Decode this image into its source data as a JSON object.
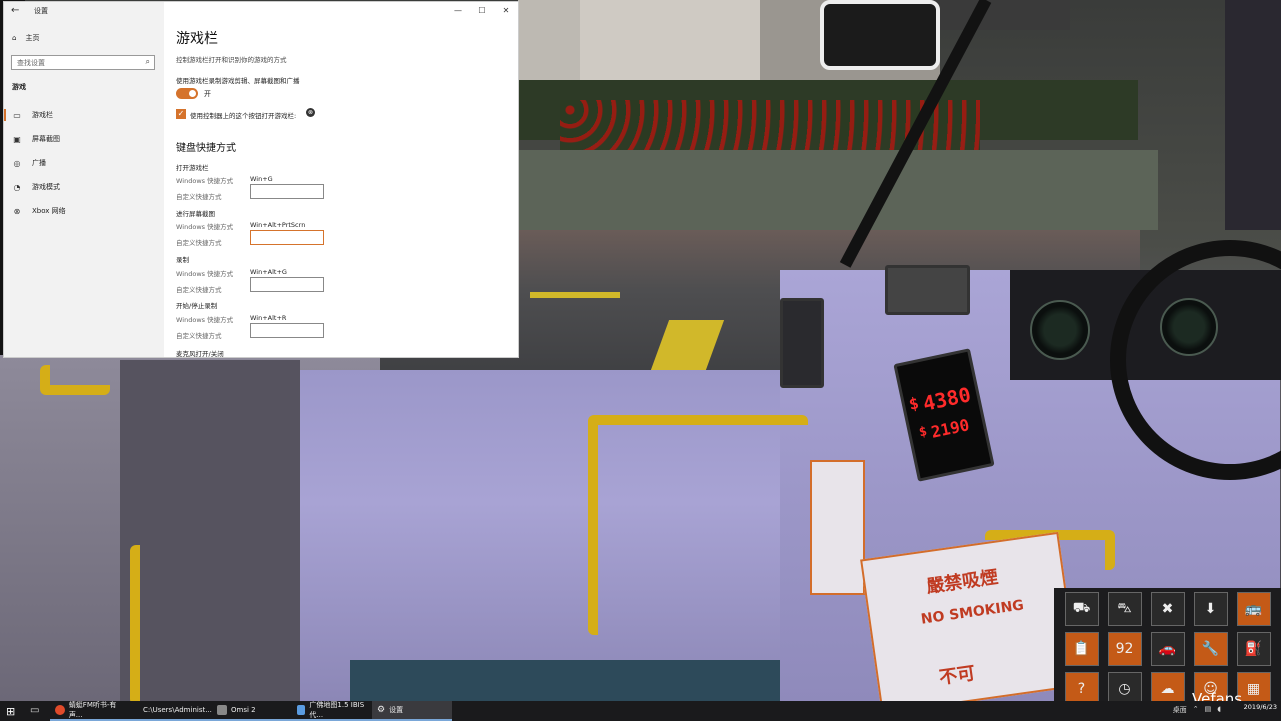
{
  "window": {
    "title": "设置",
    "controls": {
      "minimize": "—",
      "maximize": "☐",
      "close": "✕"
    }
  },
  "sidebar": {
    "home_label": "主页",
    "search_placeholder": "查找设置",
    "section_label": "游戏",
    "items": [
      {
        "label": "游戏栏",
        "icon": "game-bar-icon",
        "active": true
      },
      {
        "label": "屏幕截图",
        "icon": "screenshot-icon",
        "active": false
      },
      {
        "label": "广播",
        "icon": "broadcast-icon",
        "active": false
      },
      {
        "label": "游戏模式",
        "icon": "game-mode-icon",
        "active": false
      },
      {
        "label": "Xbox 网络",
        "icon": "xbox-icon",
        "active": false
      }
    ]
  },
  "content": {
    "title": "游戏栏",
    "description": "控制游戏栏打开和识别你的游戏的方式",
    "record_option_label": "使用游戏栏录制游戏剪辑、屏幕截图和广播",
    "toggle_state": "开",
    "checkbox_label": "使用控制器上的这个按钮打开游戏栏:",
    "shortcuts_heading": "键盘快捷方式",
    "windows_shortcut_label": "Windows 快捷方式",
    "custom_shortcut_label": "自定义快捷方式",
    "shortcuts": [
      {
        "title": "打开游戏栏",
        "windows": "Win+G"
      },
      {
        "title": "进行屏幕截图",
        "windows": "Win+Alt+PrtScrn"
      },
      {
        "title": "录制",
        "windows": "Win+Alt+G"
      },
      {
        "title": "开始/停止录制",
        "windows": "Win+Alt+R"
      }
    ],
    "next_title": "麦克风打开/关闭"
  },
  "game": {
    "fare_top": "4380",
    "fare_bottom": "2190",
    "fare_symbol": "$",
    "sign_text_1": "嚴禁吸煙",
    "sign_text_2": "NO SMOKING",
    "sign_text_3": "不可"
  },
  "watermark": "Vefans",
  "taskbar": {
    "buttons": [
      {
        "label": "蜻蜓FM听书-有声...",
        "color": "#e04a2a"
      },
      {
        "label": "C:\\Users\\Administ...",
        "color": "#e8b73a"
      },
      {
        "label": "Omsi 2",
        "color": "#888888"
      },
      {
        "label": "广佛地图1.5 IBIS代...",
        "color": "#5a9be0"
      },
      {
        "label": "设置",
        "color": "#aaaaaa"
      }
    ],
    "tray_label": "桌面",
    "time": "",
    "date": "2019/6/23"
  },
  "colors": {
    "accent": "#d5732c",
    "taskbar": "#1a1a1c"
  }
}
